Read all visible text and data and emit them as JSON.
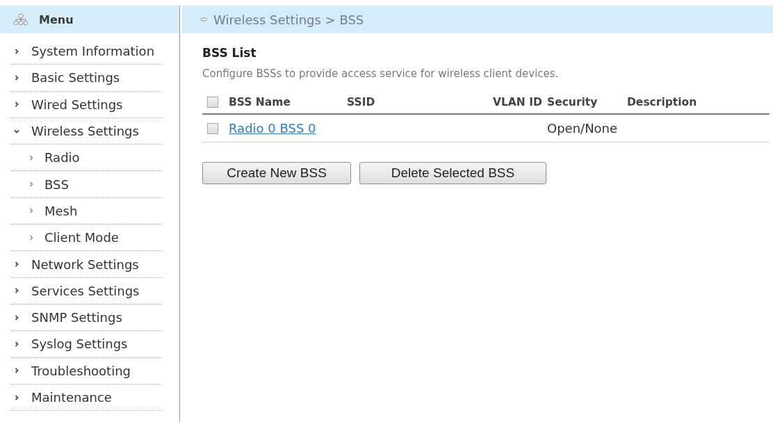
{
  "sidebar": {
    "title": "Menu",
    "items": [
      {
        "label": "System Information",
        "expanded": false
      },
      {
        "label": "Basic Settings",
        "expanded": false
      },
      {
        "label": "Wired Settings",
        "expanded": false
      },
      {
        "label": "Wireless Settings",
        "expanded": true,
        "children": [
          {
            "label": "Radio"
          },
          {
            "label": "BSS"
          },
          {
            "label": "Mesh"
          },
          {
            "label": "Client Mode"
          }
        ]
      },
      {
        "label": "Network Settings",
        "expanded": false
      },
      {
        "label": "Services Settings",
        "expanded": false
      },
      {
        "label": "SNMP Settings",
        "expanded": false
      },
      {
        "label": "Syslog Settings",
        "expanded": false
      },
      {
        "label": "Troubleshooting",
        "expanded": false
      },
      {
        "label": "Maintenance",
        "expanded": false
      }
    ]
  },
  "breadcrumb": "Wireless Settings > BSS",
  "section": {
    "title": "BSS List",
    "description": "Configure BSSs to provide access service for wireless client devices."
  },
  "table": {
    "select_all": {
      "checked": false
    },
    "columns": [
      "BSS Name",
      "SSID",
      "VLAN ID",
      "Security",
      "Description"
    ],
    "rows": [
      {
        "checked": false,
        "bss_name": "Radio 0 BSS 0",
        "security": "Open/None"
      }
    ]
  },
  "buttons": [
    "Create New BSS",
    "Delete Selected BSS"
  ]
}
